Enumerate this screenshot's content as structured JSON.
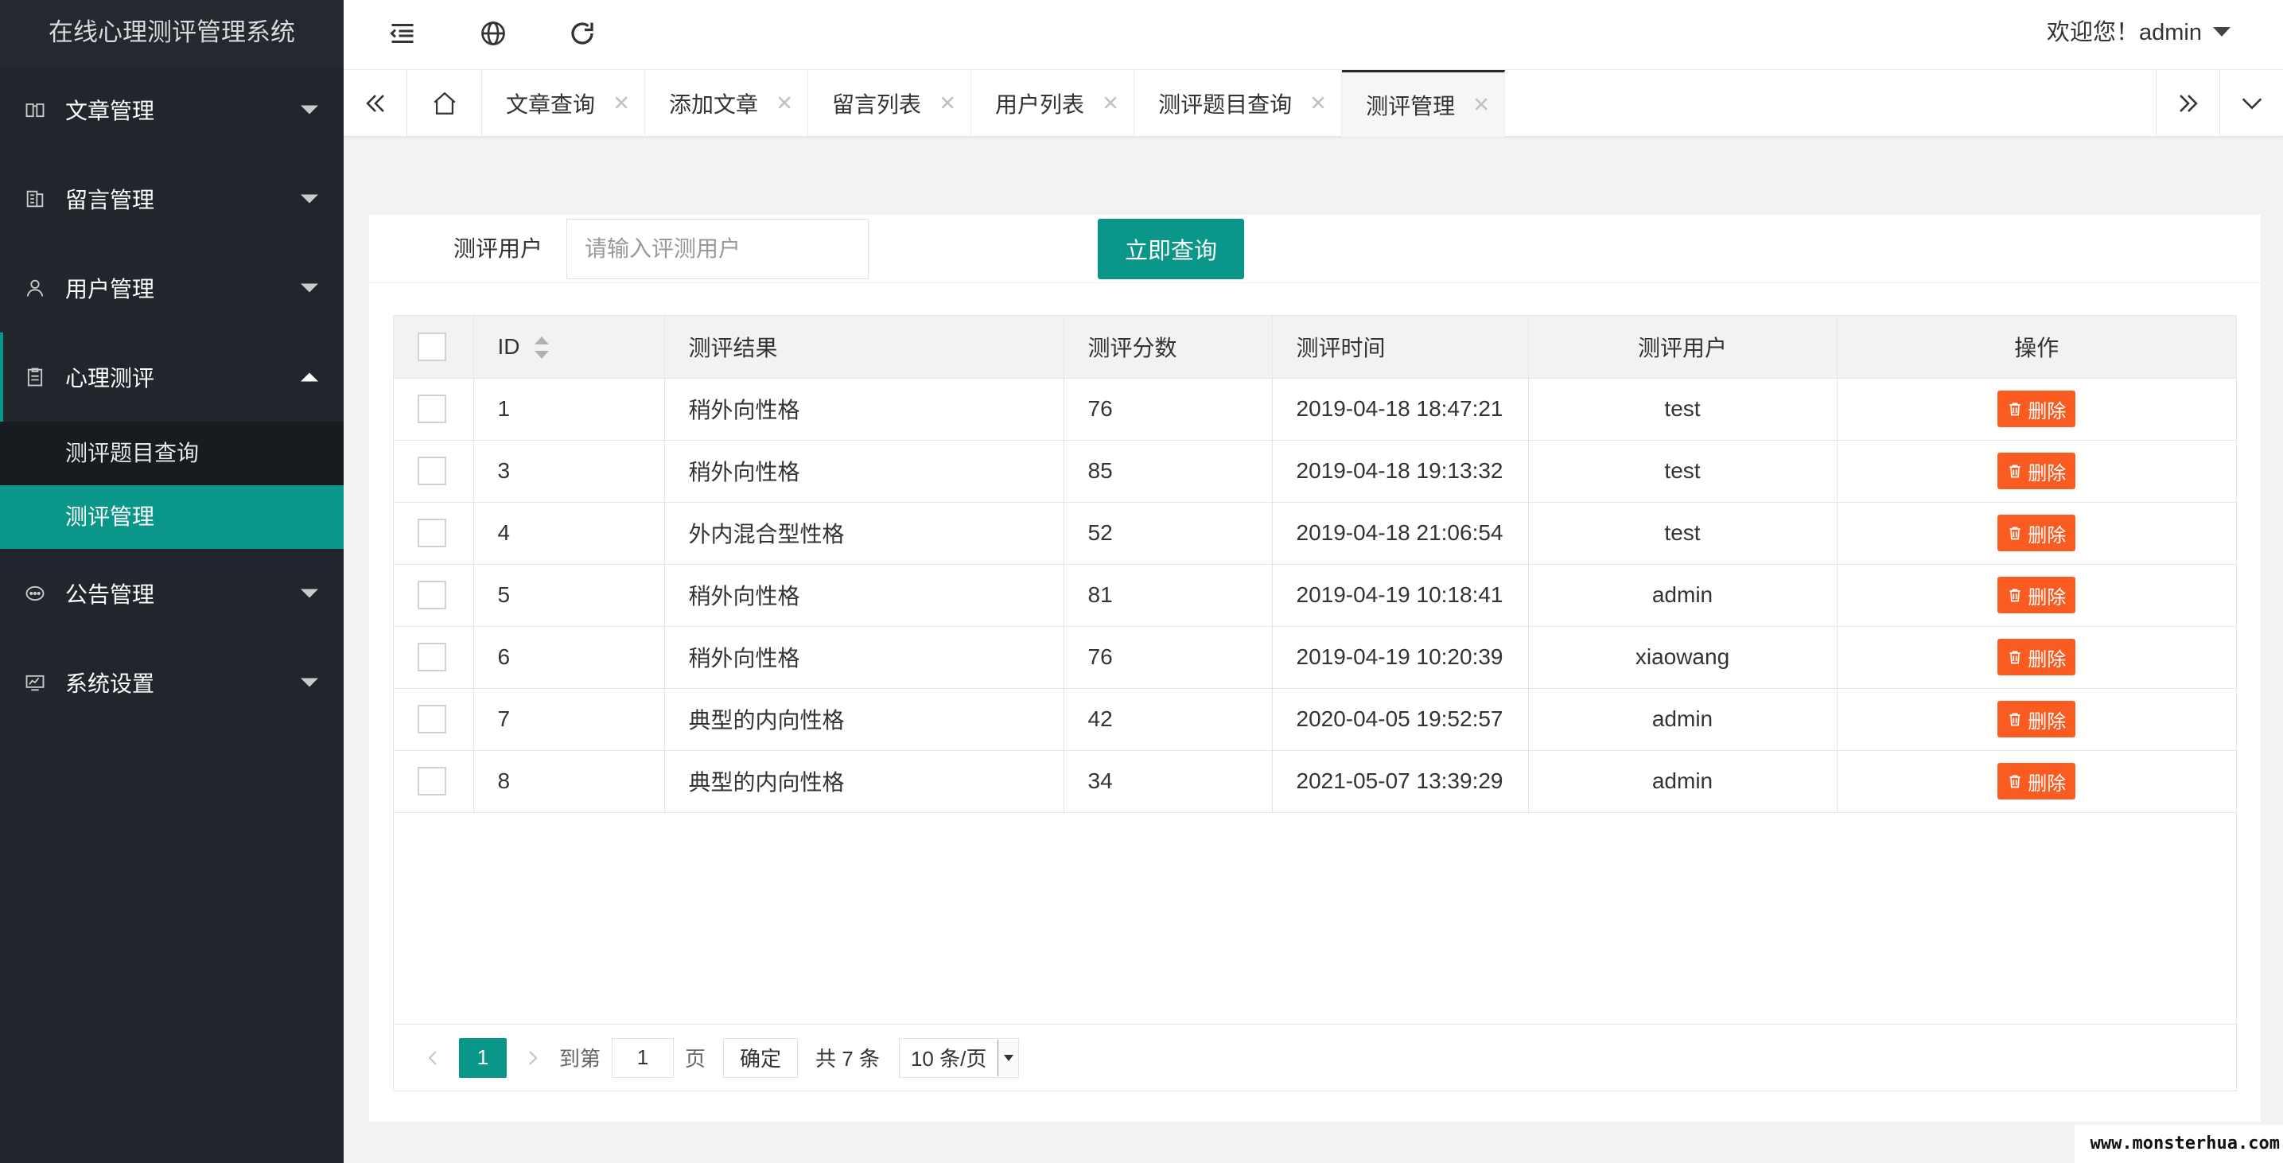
{
  "app": {
    "title": "在线心理测评管理系统"
  },
  "header": {
    "welcome": "欢迎您！admin"
  },
  "sidebar": {
    "items": [
      {
        "label": "文章管理",
        "icon": "book-icon",
        "open": false
      },
      {
        "label": "留言管理",
        "icon": "message-icon",
        "open": false
      },
      {
        "label": "用户管理",
        "icon": "user-icon",
        "open": false
      },
      {
        "label": "心理测评",
        "icon": "clipboard-icon",
        "open": true,
        "children": [
          {
            "label": "测评题目查询",
            "active": false
          },
          {
            "label": "测评管理",
            "active": true
          }
        ]
      },
      {
        "label": "公告管理",
        "icon": "chat-icon",
        "open": false
      },
      {
        "label": "系统设置",
        "icon": "monitor-icon",
        "open": false
      }
    ]
  },
  "tabs": [
    {
      "label": "文章查询",
      "active": false
    },
    {
      "label": "添加文章",
      "active": false
    },
    {
      "label": "留言列表",
      "active": false
    },
    {
      "label": "用户列表",
      "active": false
    },
    {
      "label": "测评题目查询",
      "active": false
    },
    {
      "label": "测评管理",
      "active": true
    }
  ],
  "search": {
    "label": "测评用户",
    "placeholder": "请输入评测用户",
    "value": "",
    "button": "立即查询"
  },
  "table": {
    "columns": [
      "ID",
      "测评结果",
      "测评分数",
      "测评时间",
      "测评用户",
      "操作"
    ],
    "rows": [
      {
        "id": "1",
        "result": "稍外向性格",
        "score": "76",
        "time": "2019-04-18 18:47:21",
        "user": "test"
      },
      {
        "id": "3",
        "result": "稍外向性格",
        "score": "85",
        "time": "2019-04-18 19:13:32",
        "user": "test"
      },
      {
        "id": "4",
        "result": "外内混合型性格",
        "score": "52",
        "time": "2019-04-18 21:06:54",
        "user": "test"
      },
      {
        "id": "5",
        "result": "稍外向性格",
        "score": "81",
        "time": "2019-04-19 10:18:41",
        "user": "admin"
      },
      {
        "id": "6",
        "result": "稍外向性格",
        "score": "76",
        "time": "2019-04-19 10:20:39",
        "user": "xiaowang"
      },
      {
        "id": "7",
        "result": "典型的内向性格",
        "score": "42",
        "time": "2020-04-05 19:52:57",
        "user": "admin"
      },
      {
        "id": "8",
        "result": "典型的内向性格",
        "score": "34",
        "time": "2021-05-07 13:39:29",
        "user": "admin"
      }
    ],
    "delete_label": "删除"
  },
  "pagination": {
    "current": "1",
    "goto_prefix": "到第",
    "goto_value": "1",
    "goto_suffix": "页",
    "confirm": "确定",
    "total": "共 7 条",
    "page_size": "10 条/页"
  },
  "watermark": "www.monsterhua.com",
  "colors": {
    "accent": "#0a9688",
    "danger": "#fa5b21",
    "sidebar": "#20262b"
  }
}
